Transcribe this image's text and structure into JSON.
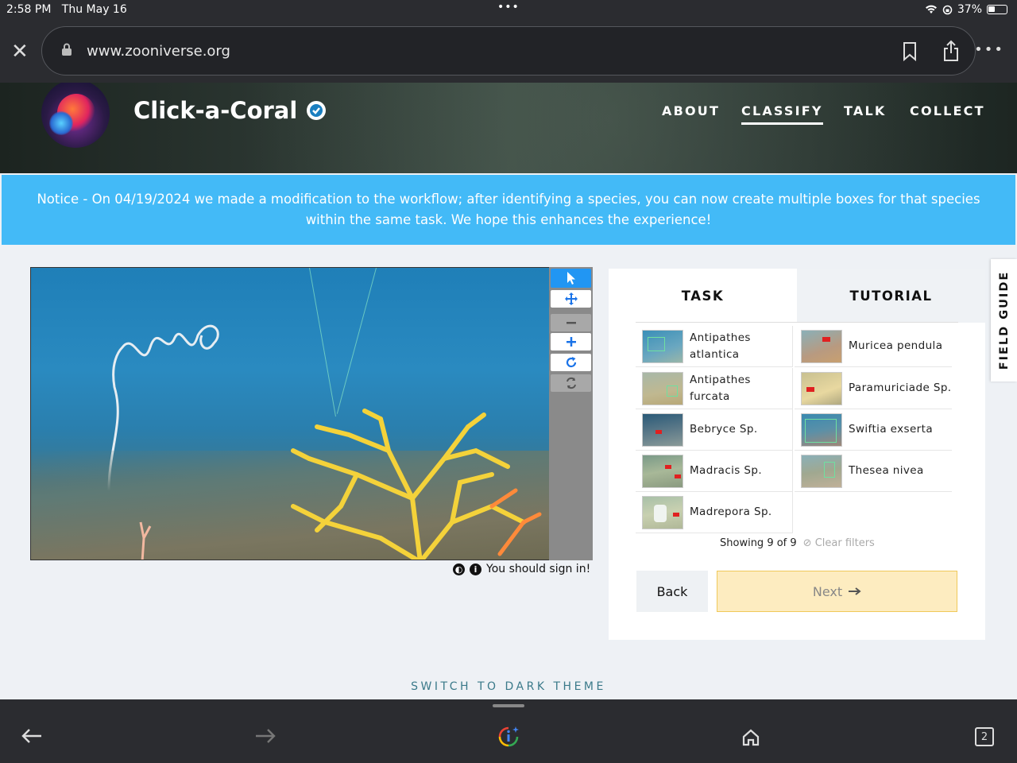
{
  "status_bar": {
    "time": "2:58 PM",
    "date": "Thu May 16",
    "battery": "37%",
    "battery_level": 0.37
  },
  "browser": {
    "url": "www.zooniverse.org",
    "tab_count": "2"
  },
  "project": {
    "title": "Click-a-Coral",
    "nav": [
      {
        "label": "ABOUT",
        "active": false
      },
      {
        "label": "CLASSIFY",
        "active": true
      },
      {
        "label": "TALK",
        "active": false
      },
      {
        "label": "COLLECT",
        "active": false
      }
    ]
  },
  "notice": "Notice - On 04/19/2024 we made a modification to the workflow; after identifying a species, you can now create multiple boxes for that species within the same task. We hope this enhances the experience!",
  "viewer": {
    "sign_in": "You should sign in!"
  },
  "tabs": {
    "task": "TASK",
    "tutorial": "TUTORIAL"
  },
  "choices": [
    {
      "label": "Antipathes atlantica"
    },
    {
      "label": "Muricea pendula"
    },
    {
      "label": "Antipathes furcata"
    },
    {
      "label": "Paramuriciade Sp."
    },
    {
      "label": "Bebryce Sp."
    },
    {
      "label": "Swiftia exserta"
    },
    {
      "label": "Madracis Sp."
    },
    {
      "label": "Thesea nivea"
    },
    {
      "label": "Madrepora Sp."
    }
  ],
  "filter": {
    "showing": "Showing 9 of 9",
    "clear": "Clear filters"
  },
  "buttons": {
    "back": "Back",
    "next": "Next"
  },
  "field_guide": "FIELD GUIDE",
  "theme_toggle": "SWITCH TO DARK THEME"
}
